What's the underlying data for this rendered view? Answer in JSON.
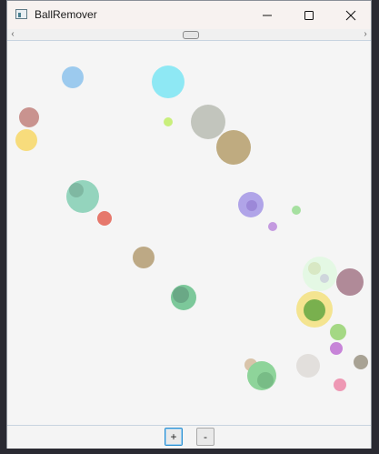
{
  "window": {
    "title": "BallRemover"
  },
  "controls": {
    "add_label": "+",
    "remove_label": "-"
  },
  "scrollbar": {
    "left_arrow": "‹",
    "right_arrow": "›"
  },
  "colors": {
    "window_bg": "#f4f4f4",
    "accent": "#2a8fd0"
  }
}
